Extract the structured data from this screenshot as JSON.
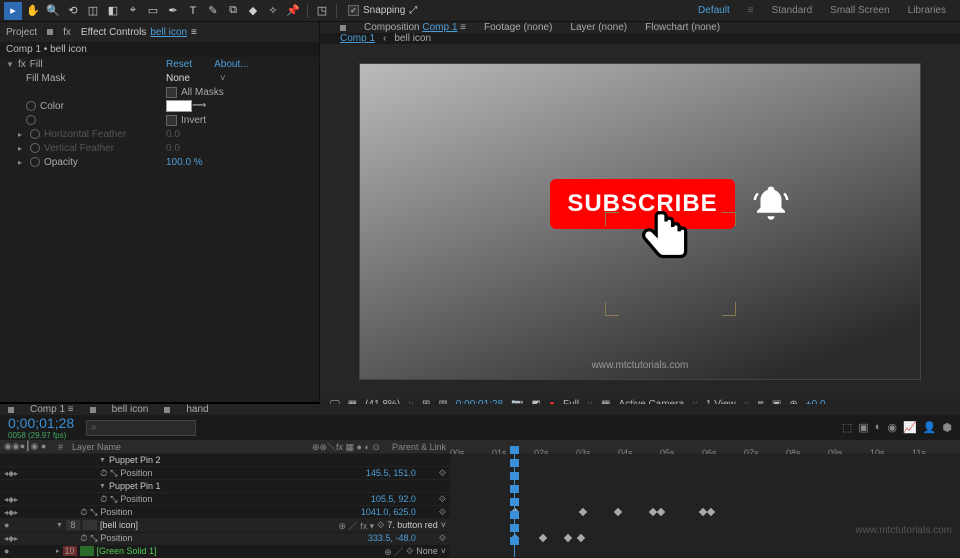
{
  "toolbar": {
    "snapping": "Snapping"
  },
  "workspace": {
    "default": "Default",
    "standard": "Standard",
    "small": "Small Screen",
    "libraries": "Libraries"
  },
  "leftPanel": {
    "projectTab": "Project",
    "effectControlsTab": "Effect Controls",
    "effectTarget": "bell icon",
    "header": "Comp 1 • bell icon",
    "fx": {
      "name": "Fill",
      "reset": "Reset",
      "about": "About...",
      "fillMask": "Fill Mask",
      "fillMaskVal": "None",
      "allMasks": "All Masks",
      "color": "Color",
      "invert": "Invert",
      "hFeather": "Horizontal Feather",
      "hFeatherVal": "0.0",
      "vFeather": "Vertical Feather",
      "vFeatherVal": "0.0",
      "opacity": "Opacity",
      "opacityVal": "100.0 %"
    }
  },
  "compTabs": {
    "composition": "Composition",
    "compName": "Comp 1",
    "footage": "Footage  (none)",
    "layer": "Layer  (none)",
    "flowchart": "Flowchart  (none)",
    "sub1": "Comp 1",
    "sub2": "bell icon"
  },
  "viewer": {
    "subscribe": "SUBSCRIBE",
    "watermark": "www.mtctutorials.com"
  },
  "viewerBar": {
    "zoom": "(41.8%)",
    "tc": "0;00;01;28",
    "quality": "Full",
    "camera": "Active Camera",
    "view": "1 View",
    "exp": "+0.0"
  },
  "timeline": {
    "tabs": {
      "comp": "Comp 1",
      "bell": "bell icon",
      "hand": "hand"
    },
    "timecode": "0;00;01;28",
    "fps": "0058 (29.97 fps)",
    "layerNameH": "Layer Name",
    "parentH": "Parent & Link",
    "ruler": [
      "00s",
      "01s",
      "02s",
      "03s",
      "04s",
      "05s",
      "06s",
      "07s",
      "08s",
      "09s",
      "10s",
      "11s"
    ],
    "rows": {
      "pp2": "Puppet Pin 2",
      "pp2pos": "Position",
      "pp2val": "145.5, 151.0",
      "pp1": "Puppet Pin 1",
      "pp1pos": "Position",
      "pp1val": "105.5, 92.0",
      "posRow": "Position",
      "posVal": "1041.0, 625.0",
      "bell": "[bell icon]",
      "bellNum": "8",
      "bellParent": "7. button red",
      "bellPos": "Position",
      "bellPosVal": "333.5, -48.0",
      "green": "[Green Solid 1]",
      "greenNum": "10",
      "greenParent": "None"
    }
  },
  "footerWm": "www.mtctutorials.com"
}
